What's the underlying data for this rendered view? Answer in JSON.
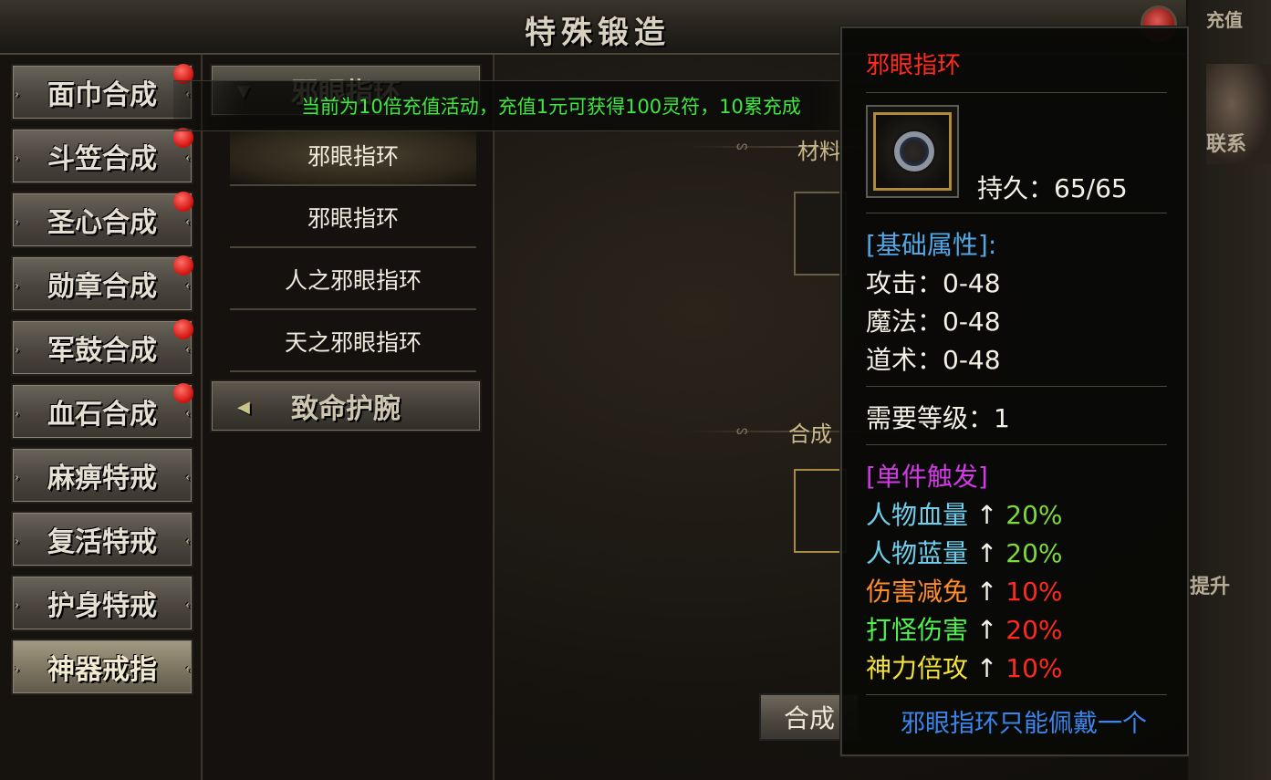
{
  "window": {
    "title": "特殊锻造"
  },
  "categories": [
    {
      "label": "面巾合成",
      "badge": true
    },
    {
      "label": "斗笠合成",
      "badge": true
    },
    {
      "label": "圣心合成",
      "badge": true
    },
    {
      "label": "勋章合成",
      "badge": true
    },
    {
      "label": "军鼓合成",
      "badge": true
    },
    {
      "label": "血石合成",
      "badge": true
    },
    {
      "label": "麻痹特戒",
      "badge": false
    },
    {
      "label": "复活特戒",
      "badge": false
    },
    {
      "label": "护身特戒",
      "badge": false
    },
    {
      "label": "神器戒指",
      "badge": false,
      "active": true
    }
  ],
  "subgroups": {
    "expanded": {
      "label": "邪眼指环"
    },
    "items": [
      "邪眼指环",
      "邪眼指环",
      "人之邪眼指环",
      "天之邪眼指环"
    ],
    "collapsed": {
      "label": "致命护腕"
    }
  },
  "marquee": {
    "text": "当前为10倍充值活动，充值1元可获得100灵符，10累充成"
  },
  "main": {
    "materials_label": "材料",
    "result_label": "合成",
    "combine_button": "合成"
  },
  "edge": {
    "top_text": "充值",
    "contact_text": "联系",
    "upgrade_text": "提升"
  },
  "tooltip": {
    "name": "邪眼指环",
    "durability": "持久：65/65",
    "base_header": "[基础属性]:",
    "base_stats": [
      "攻击：0-48",
      "魔法：0-48",
      "道术：0-48"
    ],
    "level_req": "需要等级：1",
    "trigger_header": "[单件触发]",
    "triggers": [
      {
        "name": "人物血量",
        "arrow": "↑",
        "value": "20%",
        "name_color": "#6ed0ee",
        "value_color": "#7ed83e"
      },
      {
        "name": "人物蓝量",
        "arrow": "↑",
        "value": "20%",
        "name_color": "#6ed0ee",
        "value_color": "#7ed83e"
      },
      {
        "name": "伤害减免",
        "arrow": "↑",
        "value": "10%",
        "name_color": "#ff8c2a",
        "value_color": "#ff2a1f"
      },
      {
        "name": "打怪伤害",
        "arrow": "↑",
        "value": "20%",
        "name_color": "#52ee52",
        "value_color": "#ff2a1f"
      },
      {
        "name": "神力倍攻",
        "arrow": "↑",
        "value": "10%",
        "name_color": "#f2e23a",
        "value_color": "#ff2a1f"
      }
    ],
    "note": "邪眼指环只能佩戴一个"
  }
}
